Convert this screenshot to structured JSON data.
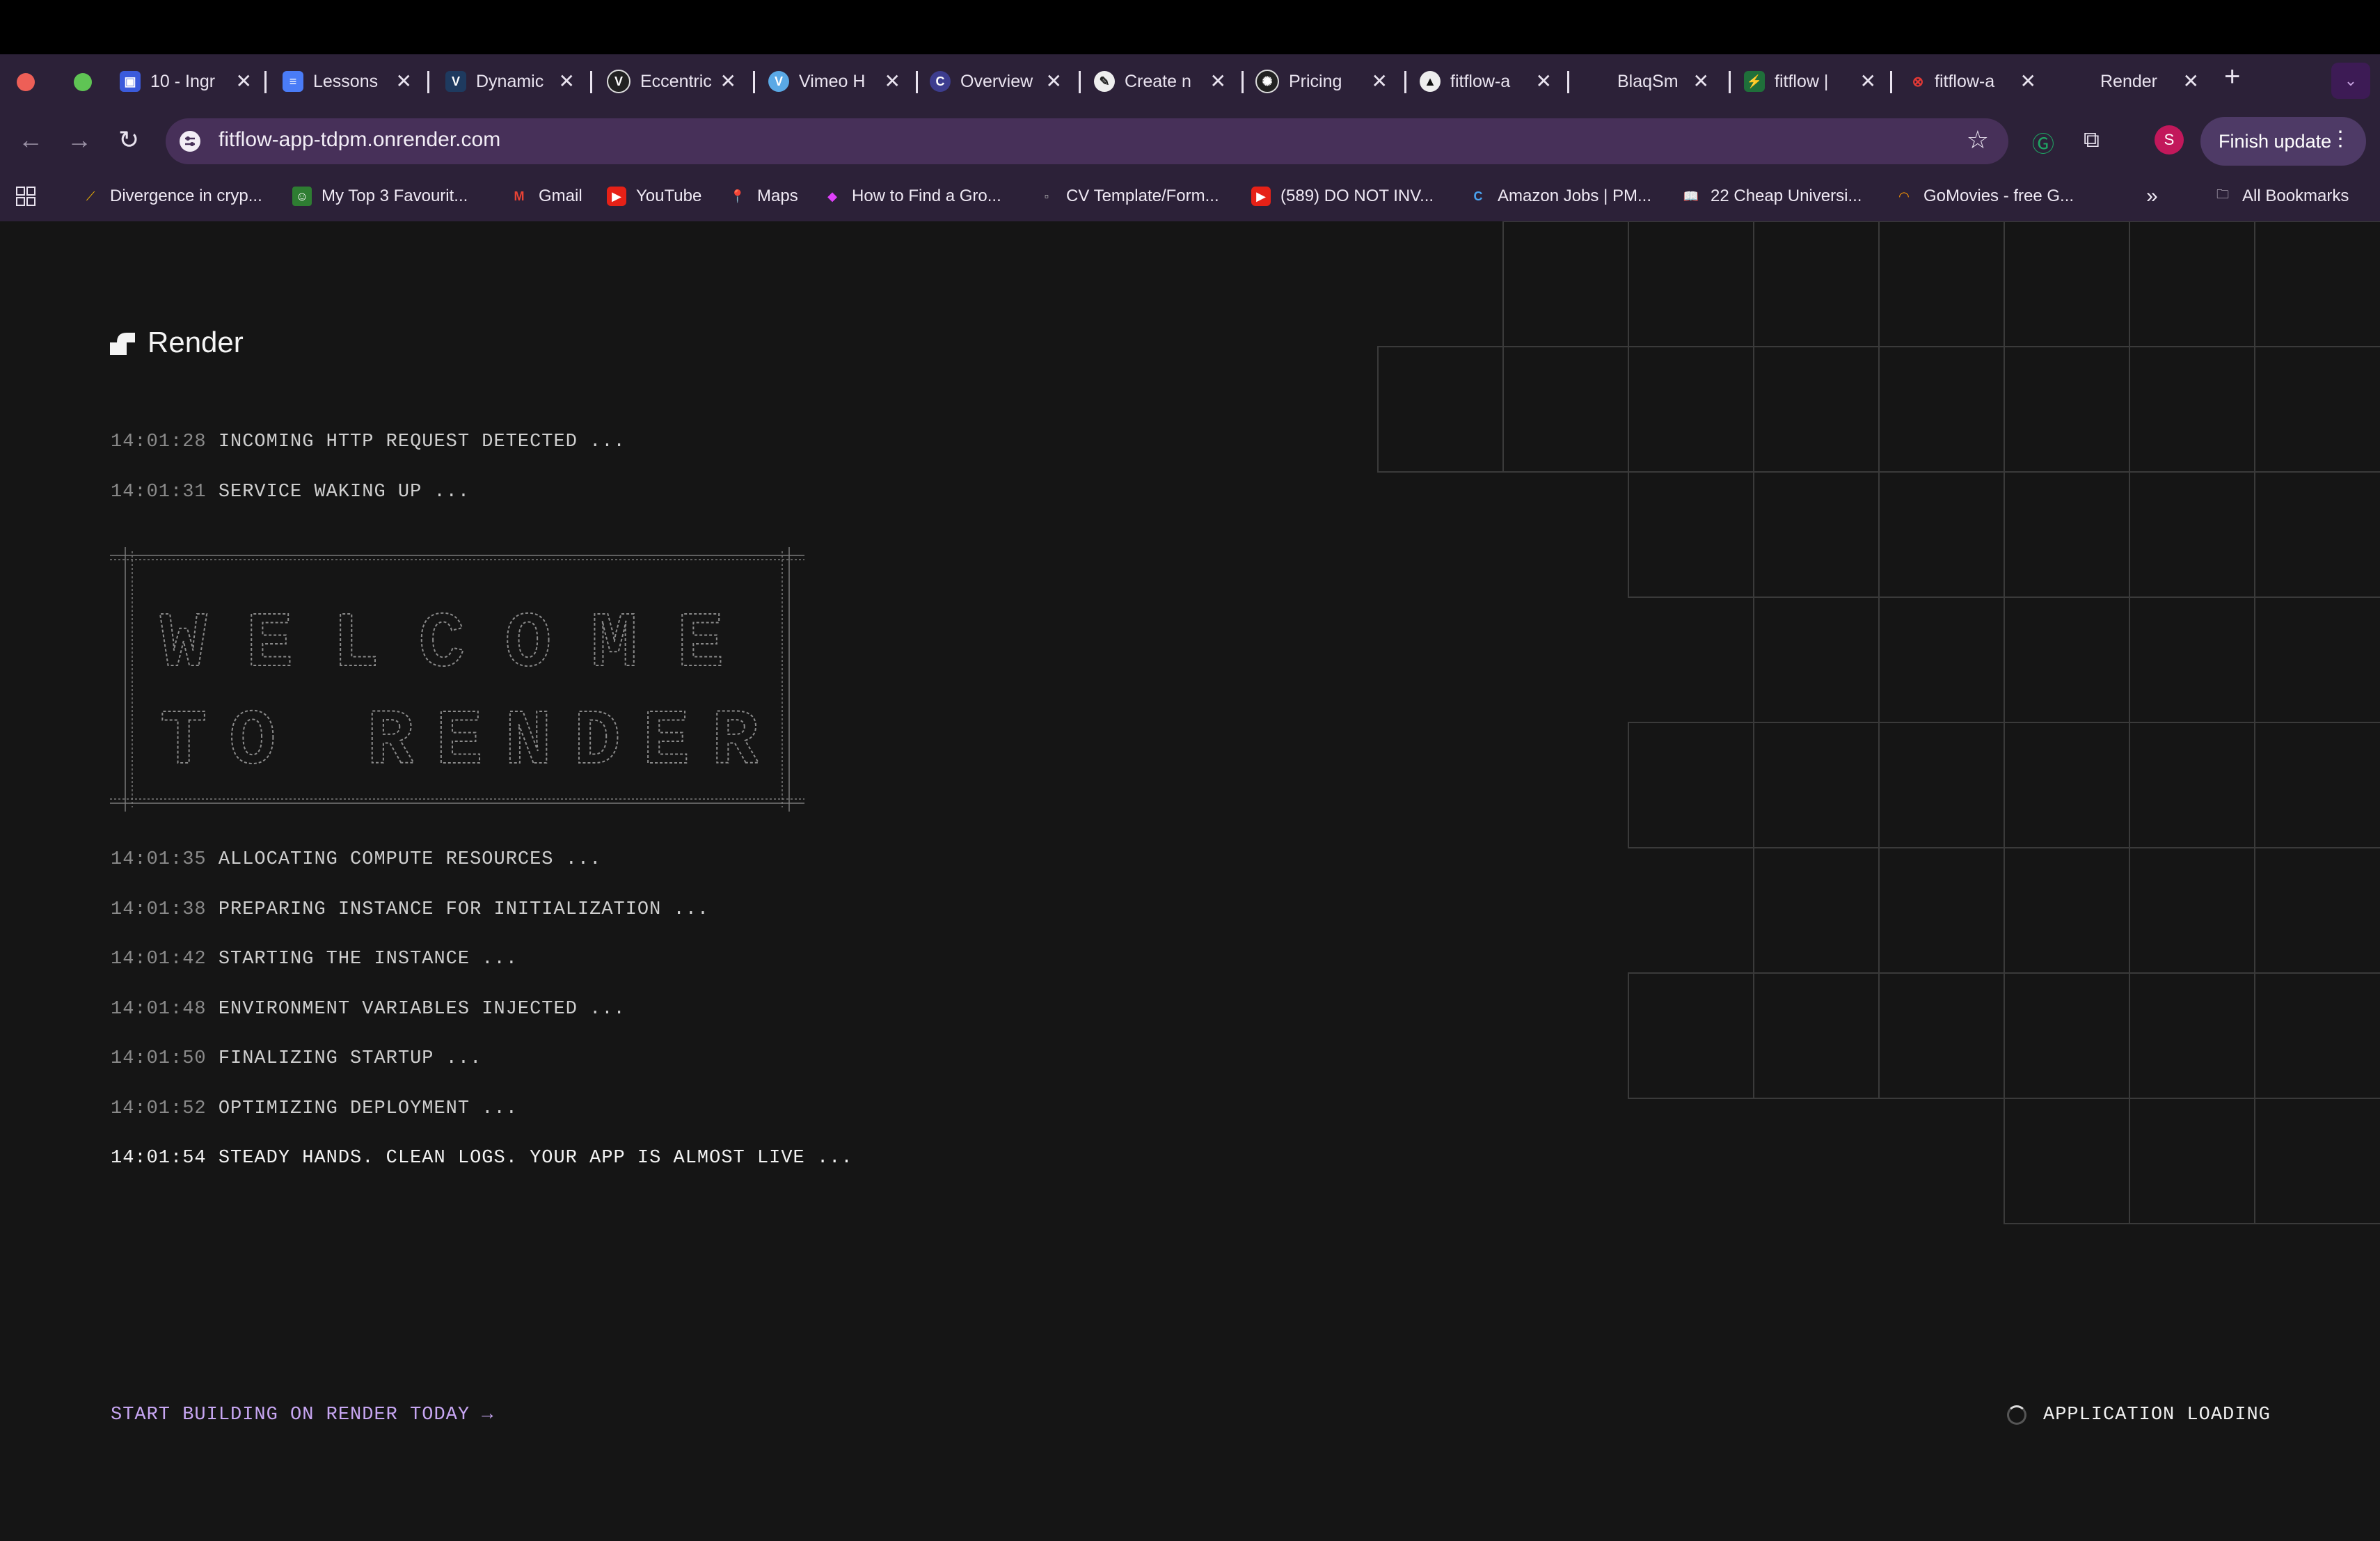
{
  "browser": {
    "tabs": [
      {
        "title": "10 - Ingr",
        "icon": "page-icon",
        "color": "#3b5bdb"
      },
      {
        "title": "Lessons",
        "icon": "docs-icon",
        "color": "#4a7cf7"
      },
      {
        "title": "Dynamic",
        "icon": "v-logo-icon",
        "color": "#1e3a5f"
      },
      {
        "title": "Eccentric",
        "icon": "v-circle-icon",
        "color": "#222"
      },
      {
        "title": "Vimeo H",
        "icon": "vimeo-icon",
        "color": "#5aa9e6"
      },
      {
        "title": "Overview",
        "icon": "circle-logo-icon",
        "color": "#3d3d8f"
      },
      {
        "title": "Create n",
        "icon": "pen-icon",
        "color": "#222"
      },
      {
        "title": "Pricing",
        "icon": "openai-icon",
        "color": "#222"
      },
      {
        "title": "fitflow-a",
        "icon": "triangle-icon",
        "color": "#111"
      },
      {
        "title": "BlaqSm",
        "icon": "",
        "color": ""
      },
      {
        "title": "fitflow |",
        "icon": "bolt-icon",
        "color": "#1f6f3a"
      },
      {
        "title": "fitflow-a",
        "icon": "error-icon",
        "color": "#c62828"
      },
      {
        "title": "Render",
        "icon": "",
        "color": ""
      }
    ],
    "url": "fitflow-app-tdpm.onrender.com",
    "profile_initial": "S",
    "finish_update_label": "Finish update",
    "bookmarks": [
      {
        "label": "Divergence in cryp...",
        "icon": "chart-icon"
      },
      {
        "label": "My Top 3 Favourit...",
        "icon": "robot-icon"
      },
      {
        "label": "Gmail",
        "icon": "gmail-icon"
      },
      {
        "label": "YouTube",
        "icon": "youtube-icon"
      },
      {
        "label": "Maps",
        "icon": "maps-icon"
      },
      {
        "label": "How to Find a Gro...",
        "icon": "brand-icon"
      },
      {
        "label": "CV Template/Form...",
        "icon": "doc-icon"
      },
      {
        "label": "(589) DO NOT INV...",
        "icon": "youtube-icon"
      },
      {
        "label": "Amazon Jobs | PM...",
        "icon": "c-icon"
      },
      {
        "label": "22 Cheap Universi...",
        "icon": "book-icon"
      },
      {
        "label": "GoMovies - free G...",
        "icon": "rainbow-icon"
      }
    ],
    "all_bookmarks_label": "All Bookmarks"
  },
  "page": {
    "logo_text": "Render",
    "logs_top": [
      {
        "time": "14:01:28",
        "msg": "INCOMING HTTP REQUEST DETECTED ..."
      },
      {
        "time": "14:01:31",
        "msg": "SERVICE WAKING UP ..."
      }
    ],
    "ascii_banner": [
      "WELCOME",
      "TO RENDER"
    ],
    "logs_bottom": [
      {
        "time": "14:01:35",
        "msg": "ALLOCATING COMPUTE RESOURCES ..."
      },
      {
        "time": "14:01:38",
        "msg": "PREPARING INSTANCE FOR INITIALIZATION ..."
      },
      {
        "time": "14:01:42",
        "msg": "STARTING THE INSTANCE ..."
      },
      {
        "time": "14:01:48",
        "msg": "ENVIRONMENT VARIABLES INJECTED ..."
      },
      {
        "time": "14:01:50",
        "msg": "FINALIZING STARTUP ..."
      },
      {
        "time": "14:01:52",
        "msg": "OPTIMIZING DEPLOYMENT ..."
      },
      {
        "time": "14:01:54",
        "msg": "STEADY HANDS. CLEAN LOGS. YOUR APP IS ALMOST LIVE ..."
      }
    ],
    "cta_label": "START BUILDING ON RENDER TODAY →",
    "status_label": "APPLICATION LOADING"
  },
  "colors": {
    "background": "#151515",
    "accent": "#c7a6f2",
    "grid_line": "#3a3a3a",
    "chrome": "#2c2138"
  }
}
